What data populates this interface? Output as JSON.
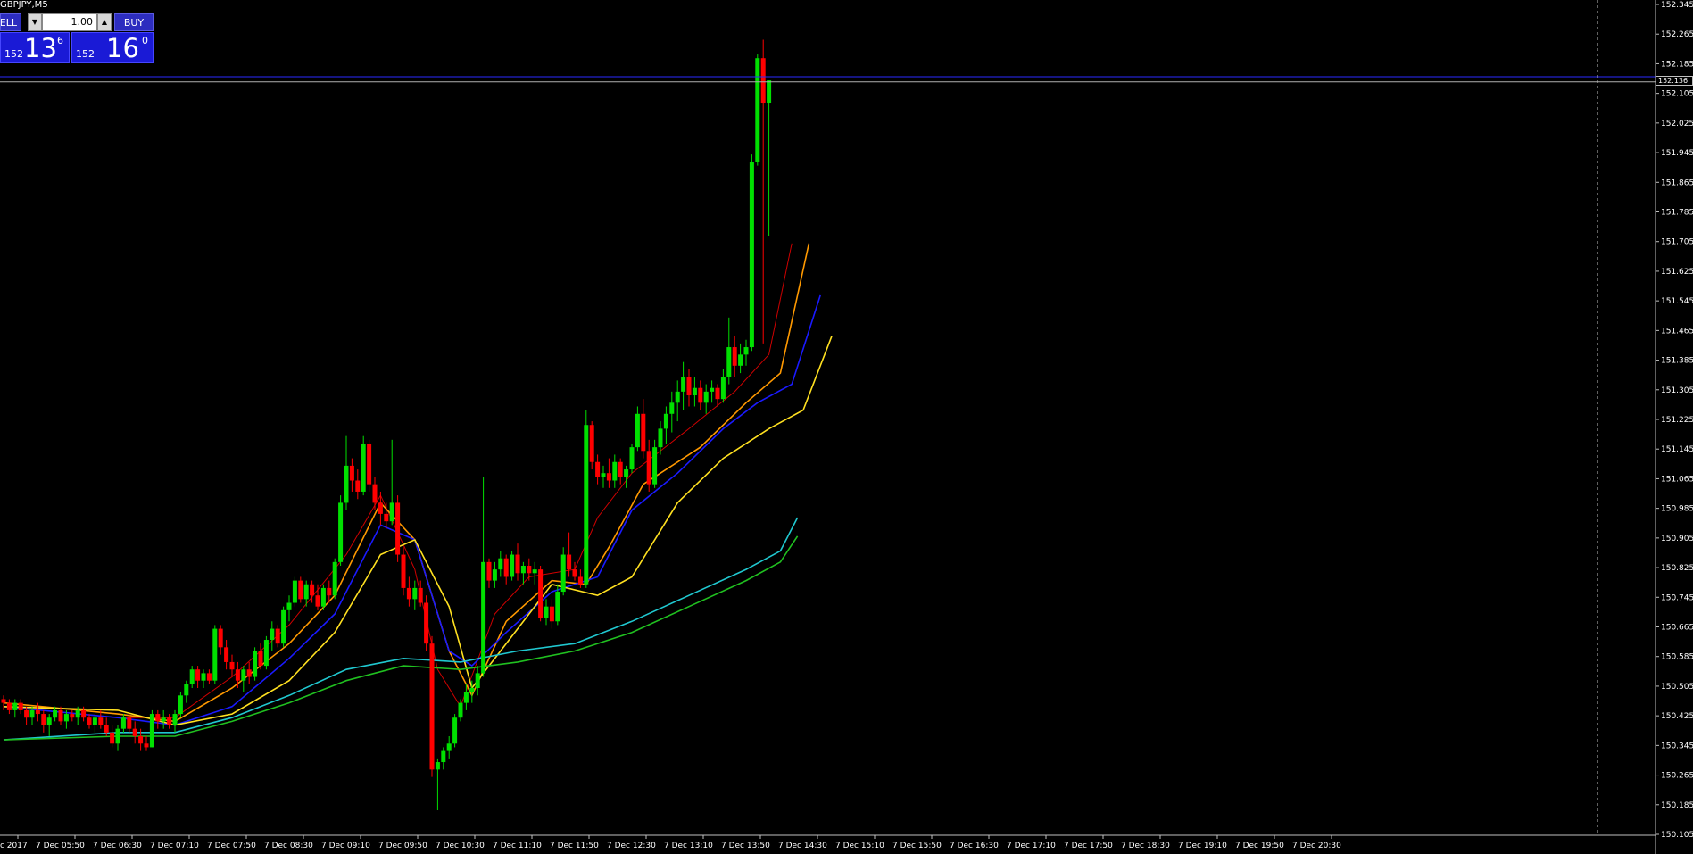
{
  "window": {
    "symbol_label": "GBPJPY,M5"
  },
  "trade_panel": {
    "sell_label": "ELL",
    "buy_label": "BUY",
    "lot_value": "1.00",
    "lot_down_icon": "arrow-down-icon",
    "lot_up_icon": "arrow-up-icon",
    "sell_quote": {
      "prefix": "152",
      "big": "13",
      "sup": "6"
    },
    "buy_quote": {
      "prefix": "152",
      "big": "16",
      "sup": "0"
    }
  },
  "price_tag": "152.136",
  "colors": {
    "bull": "#00e000",
    "bear": "#ff0000",
    "ma_red": "#d00000",
    "ma_orange": "#ff9900",
    "ma_blue": "#1a1aff",
    "ma_yellow": "#ffe020",
    "ma_cyan": "#20c8d0",
    "ma_green": "#20c020",
    "ask_line": "#2a2aff",
    "bid_line": "#b0b0b0"
  },
  "chart_data": {
    "type": "candlestick",
    "y_tick_labels": [
      "152.345",
      "152.265",
      "152.185",
      "152.105",
      "152.025",
      "151.945",
      "151.865",
      "151.785",
      "151.705",
      "151.625",
      "151.545",
      "151.465",
      "151.385",
      "151.305",
      "151.225",
      "151.145",
      "151.065",
      "150.985",
      "150.905",
      "150.825",
      "150.745",
      "150.665",
      "150.585",
      "150.505",
      "150.425",
      "150.345",
      "150.265",
      "150.185",
      "150.105"
    ],
    "x_tick_labels": [
      "c 2017",
      "7 Dec 05:50",
      "7 Dec 06:30",
      "7 Dec 07:10",
      "7 Dec 07:50",
      "7 Dec 08:30",
      "7 Dec 09:10",
      "7 Dec 09:50",
      "7 Dec 10:30",
      "7 Dec 11:10",
      "7 Dec 11:50",
      "7 Dec 12:30",
      "7 Dec 13:10",
      "7 Dec 13:50",
      "7 Dec 14:30",
      "7 Dec 15:10",
      "7 Dec 15:50",
      "7 Dec 16:30",
      "7 Dec 17:10",
      "7 Dec 17:50",
      "7 Dec 18:30",
      "7 Dec 19:10",
      "7 Dec 19:50",
      "7 Dec 20:30"
    ],
    "ask_level": 152.15,
    "bid_level": 152.136,
    "ohlc": [
      [
        150.47,
        150.48,
        150.44,
        150.46
      ],
      [
        150.46,
        150.47,
        150.43,
        150.44
      ],
      [
        150.44,
        150.47,
        150.42,
        150.46
      ],
      [
        150.46,
        150.47,
        150.43,
        150.44
      ],
      [
        150.44,
        150.45,
        150.4,
        150.42
      ],
      [
        150.42,
        150.45,
        150.4,
        150.44
      ],
      [
        150.44,
        150.46,
        150.41,
        150.43
      ],
      [
        150.43,
        150.44,
        150.38,
        150.4
      ],
      [
        150.4,
        150.43,
        150.37,
        150.42
      ],
      [
        150.42,
        150.45,
        150.41,
        150.44
      ],
      [
        150.44,
        150.45,
        150.4,
        150.41
      ],
      [
        150.41,
        150.44,
        150.39,
        150.43
      ],
      [
        150.43,
        150.44,
        150.41,
        150.42
      ],
      [
        150.42,
        150.45,
        150.4,
        150.44
      ],
      [
        150.44,
        150.45,
        150.41,
        150.42
      ],
      [
        150.42,
        150.43,
        150.39,
        150.4
      ],
      [
        150.4,
        150.43,
        150.38,
        150.42
      ],
      [
        150.42,
        150.44,
        150.39,
        150.4
      ],
      [
        150.4,
        150.42,
        150.37,
        150.38
      ],
      [
        150.38,
        150.4,
        150.34,
        150.35
      ],
      [
        150.35,
        150.4,
        150.33,
        150.39
      ],
      [
        150.39,
        150.43,
        150.38,
        150.42
      ],
      [
        150.42,
        150.43,
        150.38,
        150.39
      ],
      [
        150.39,
        150.41,
        150.35,
        150.37
      ],
      [
        150.37,
        150.39,
        150.33,
        150.35
      ],
      [
        150.35,
        150.37,
        150.33,
        150.34
      ],
      [
        150.34,
        150.44,
        150.34,
        150.43
      ],
      [
        150.43,
        150.44,
        150.39,
        150.41
      ],
      [
        150.41,
        150.44,
        150.39,
        150.42
      ],
      [
        150.42,
        150.43,
        150.39,
        150.4
      ],
      [
        150.4,
        150.44,
        150.38,
        150.43
      ],
      [
        150.43,
        150.49,
        150.42,
        150.48
      ],
      [
        150.48,
        150.52,
        150.46,
        150.51
      ],
      [
        150.51,
        150.56,
        150.5,
        150.55
      ],
      [
        150.55,
        150.56,
        150.5,
        150.52
      ],
      [
        150.52,
        150.55,
        150.5,
        150.54
      ],
      [
        150.54,
        150.55,
        150.51,
        150.52
      ],
      [
        150.52,
        150.67,
        150.51,
        150.66
      ],
      [
        150.66,
        150.67,
        150.59,
        150.61
      ],
      [
        150.61,
        150.63,
        150.55,
        150.57
      ],
      [
        150.57,
        150.59,
        150.53,
        150.55
      ],
      [
        150.55,
        150.57,
        150.5,
        150.52
      ],
      [
        150.52,
        150.56,
        150.49,
        150.55
      ],
      [
        150.55,
        150.57,
        150.51,
        150.53
      ],
      [
        150.53,
        150.61,
        150.52,
        150.6
      ],
      [
        150.6,
        150.62,
        150.55,
        150.56
      ],
      [
        150.56,
        150.64,
        150.55,
        150.63
      ],
      [
        150.63,
        150.68,
        150.6,
        150.66
      ],
      [
        150.66,
        150.67,
        150.61,
        150.62
      ],
      [
        150.62,
        150.72,
        150.61,
        150.71
      ],
      [
        150.71,
        150.75,
        150.68,
        150.73
      ],
      [
        150.73,
        150.8,
        150.72,
        150.79
      ],
      [
        150.79,
        150.8,
        150.73,
        150.74
      ],
      [
        150.74,
        150.79,
        150.72,
        150.78
      ],
      [
        150.78,
        150.79,
        150.73,
        150.75
      ],
      [
        150.75,
        150.78,
        150.71,
        150.72
      ],
      [
        150.72,
        150.78,
        150.71,
        150.77
      ],
      [
        150.77,
        150.79,
        150.73,
        150.75
      ],
      [
        150.75,
        150.85,
        150.74,
        150.84
      ],
      [
        150.84,
        151.02,
        150.83,
        151.0
      ],
      [
        151.0,
        151.18,
        150.98,
        151.1
      ],
      [
        151.1,
        151.12,
        151.03,
        151.06
      ],
      [
        151.06,
        151.09,
        151.01,
        151.03
      ],
      [
        151.03,
        151.18,
        151.02,
        151.16
      ],
      [
        151.16,
        151.17,
        151.03,
        151.05
      ],
      [
        151.05,
        151.07,
        150.98,
        151.0
      ],
      [
        151.0,
        151.03,
        150.94,
        150.97
      ],
      [
        150.97,
        151.0,
        150.93,
        150.95
      ],
      [
        150.95,
        151.17,
        150.94,
        151.0
      ],
      [
        151.0,
        151.02,
        150.84,
        150.86
      ],
      [
        150.86,
        150.88,
        150.75,
        150.77
      ],
      [
        150.77,
        150.8,
        150.72,
        150.74
      ],
      [
        150.74,
        150.79,
        150.71,
        150.77
      ],
      [
        150.77,
        150.79,
        150.72,
        150.73
      ],
      [
        150.73,
        150.75,
        150.6,
        150.62
      ],
      [
        150.62,
        150.64,
        150.26,
        150.28
      ],
      [
        150.28,
        150.31,
        150.17,
        150.3
      ],
      [
        150.3,
        150.34,
        150.28,
        150.33
      ],
      [
        150.33,
        150.37,
        150.31,
        150.35
      ],
      [
        150.35,
        150.43,
        150.34,
        150.42
      ],
      [
        150.42,
        150.47,
        150.41,
        150.46
      ],
      [
        150.46,
        150.51,
        150.44,
        150.49
      ],
      [
        150.49,
        150.52,
        150.46,
        150.5
      ],
      [
        150.5,
        150.56,
        150.48,
        150.54
      ],
      [
        150.54,
        151.07,
        150.53,
        150.84
      ],
      [
        150.84,
        150.85,
        150.77,
        150.79
      ],
      [
        150.79,
        150.84,
        150.77,
        150.82
      ],
      [
        150.82,
        150.87,
        150.8,
        150.85
      ],
      [
        150.85,
        150.86,
        150.78,
        150.8
      ],
      [
        150.8,
        150.87,
        150.79,
        150.86
      ],
      [
        150.86,
        150.89,
        150.79,
        150.81
      ],
      [
        150.81,
        150.84,
        150.78,
        150.83
      ],
      [
        150.83,
        150.85,
        150.79,
        150.81
      ],
      [
        150.81,
        150.84,
        150.78,
        150.82
      ],
      [
        150.82,
        150.83,
        150.68,
        150.69
      ],
      [
        150.69,
        150.74,
        150.67,
        150.72
      ],
      [
        150.72,
        150.74,
        150.66,
        150.68
      ],
      [
        150.68,
        150.78,
        150.67,
        150.76
      ],
      [
        150.76,
        150.88,
        150.75,
        150.86
      ],
      [
        150.86,
        150.92,
        150.8,
        150.82
      ],
      [
        150.82,
        150.84,
        150.79,
        150.8
      ],
      [
        150.8,
        150.82,
        150.77,
        150.78
      ],
      [
        150.78,
        151.25,
        150.77,
        151.21
      ],
      [
        151.21,
        151.22,
        151.09,
        151.11
      ],
      [
        151.11,
        151.13,
        151.05,
        151.07
      ],
      [
        151.07,
        151.1,
        151.04,
        151.08
      ],
      [
        151.08,
        151.12,
        151.04,
        151.06
      ],
      [
        151.06,
        151.13,
        151.04,
        151.11
      ],
      [
        151.11,
        151.12,
        151.05,
        151.07
      ],
      [
        151.07,
        151.1,
        151.04,
        151.09
      ],
      [
        151.09,
        151.16,
        151.08,
        151.15
      ],
      [
        151.15,
        151.26,
        151.14,
        151.24
      ],
      [
        151.24,
        151.28,
        151.12,
        151.14
      ],
      [
        151.14,
        151.17,
        151.03,
        151.05
      ],
      [
        151.05,
        151.17,
        151.04,
        151.15
      ],
      [
        151.15,
        151.22,
        151.13,
        151.2
      ],
      [
        151.2,
        151.26,
        151.16,
        151.24
      ],
      [
        151.24,
        151.3,
        151.19,
        151.27
      ],
      [
        151.27,
        151.33,
        151.22,
        151.3
      ],
      [
        151.3,
        151.38,
        151.25,
        151.34
      ],
      [
        151.34,
        151.36,
        151.26,
        151.29
      ],
      [
        151.29,
        151.34,
        151.26,
        151.31
      ],
      [
        151.31,
        151.33,
        151.25,
        151.27
      ],
      [
        151.27,
        151.32,
        151.24,
        151.3
      ],
      [
        151.3,
        151.33,
        151.27,
        151.31
      ],
      [
        151.31,
        151.32,
        151.26,
        151.28
      ],
      [
        151.28,
        151.36,
        151.27,
        151.34
      ],
      [
        151.34,
        151.5,
        151.32,
        151.42
      ],
      [
        151.42,
        151.45,
        151.34,
        151.37
      ],
      [
        151.37,
        151.43,
        151.35,
        151.4
      ],
      [
        151.4,
        151.44,
        151.37,
        151.42
      ],
      [
        151.42,
        151.94,
        151.41,
        151.92
      ],
      [
        151.92,
        152.21,
        151.91,
        152.2
      ],
      [
        152.2,
        152.25,
        151.43,
        152.08
      ],
      [
        152.08,
        152.14,
        151.72,
        152.14
      ]
    ],
    "ma_series": [
      {
        "color": "ma_red",
        "values": [
          [
            0,
            150.45
          ],
          [
            20,
            150.42
          ],
          [
            30,
            150.42
          ],
          [
            40,
            150.53
          ],
          [
            50,
            150.67
          ],
          [
            60,
            150.86
          ],
          [
            66,
            151.02
          ],
          [
            72,
            150.82
          ],
          [
            76,
            150.55
          ],
          [
            80,
            150.45
          ],
          [
            86,
            150.7
          ],
          [
            92,
            150.8
          ],
          [
            100,
            150.82
          ],
          [
            104,
            150.96
          ],
          [
            110,
            151.08
          ],
          [
            120,
            151.2
          ],
          [
            128,
            151.3
          ],
          [
            134,
            151.4
          ],
          [
            138,
            151.7
          ]
        ]
      },
      {
        "color": "ma_orange",
        "values": [
          [
            0,
            150.46
          ],
          [
            20,
            150.43
          ],
          [
            30,
            150.41
          ],
          [
            40,
            150.5
          ],
          [
            50,
            150.62
          ],
          [
            58,
            150.75
          ],
          [
            66,
            151.0
          ],
          [
            72,
            150.9
          ],
          [
            78,
            150.6
          ],
          [
            82,
            150.48
          ],
          [
            88,
            150.68
          ],
          [
            96,
            150.79
          ],
          [
            102,
            150.78
          ],
          [
            106,
            150.88
          ],
          [
            112,
            151.05
          ],
          [
            122,
            151.15
          ],
          [
            130,
            151.27
          ],
          [
            136,
            151.35
          ],
          [
            141,
            151.7
          ]
        ]
      },
      {
        "color": "ma_blue",
        "values": [
          [
            0,
            150.45
          ],
          [
            20,
            150.42
          ],
          [
            30,
            150.4
          ],
          [
            40,
            150.45
          ],
          [
            50,
            150.58
          ],
          [
            58,
            150.7
          ],
          [
            66,
            150.94
          ],
          [
            72,
            150.9
          ],
          [
            78,
            150.6
          ],
          [
            82,
            150.56
          ],
          [
            88,
            150.65
          ],
          [
            96,
            150.76
          ],
          [
            104,
            150.8
          ],
          [
            110,
            150.98
          ],
          [
            118,
            151.08
          ],
          [
            126,
            151.2
          ],
          [
            132,
            151.27
          ],
          [
            138,
            151.32
          ],
          [
            143,
            151.56
          ]
        ]
      },
      {
        "color": "ma_yellow",
        "values": [
          [
            0,
            150.45
          ],
          [
            20,
            150.44
          ],
          [
            30,
            150.4
          ],
          [
            40,
            150.43
          ],
          [
            50,
            150.52
          ],
          [
            58,
            150.65
          ],
          [
            66,
            150.86
          ],
          [
            72,
            150.9
          ],
          [
            78,
            150.72
          ],
          [
            82,
            150.5
          ],
          [
            88,
            150.62
          ],
          [
            96,
            150.78
          ],
          [
            104,
            150.75
          ],
          [
            110,
            150.8
          ],
          [
            118,
            151.0
          ],
          [
            126,
            151.12
          ],
          [
            134,
            151.2
          ],
          [
            140,
            151.25
          ],
          [
            145,
            151.45
          ]
        ]
      },
      {
        "color": "ma_cyan",
        "values": [
          [
            0,
            150.36
          ],
          [
            20,
            150.38
          ],
          [
            30,
            150.38
          ],
          [
            40,
            150.42
          ],
          [
            50,
            150.48
          ],
          [
            60,
            150.55
          ],
          [
            70,
            150.58
          ],
          [
            80,
            150.57
          ],
          [
            90,
            150.6
          ],
          [
            100,
            150.62
          ],
          [
            110,
            150.68
          ],
          [
            120,
            150.75
          ],
          [
            130,
            150.82
          ],
          [
            136,
            150.87
          ],
          [
            139,
            150.96
          ]
        ]
      },
      {
        "color": "ma_green",
        "values": [
          [
            0,
            150.36
          ],
          [
            20,
            150.37
          ],
          [
            30,
            150.37
          ],
          [
            40,
            150.41
          ],
          [
            50,
            150.46
          ],
          [
            60,
            150.52
          ],
          [
            70,
            150.56
          ],
          [
            80,
            150.55
          ],
          [
            90,
            150.57
          ],
          [
            100,
            150.6
          ],
          [
            110,
            150.65
          ],
          [
            120,
            150.72
          ],
          [
            130,
            150.79
          ],
          [
            136,
            150.84
          ],
          [
            139,
            150.91
          ]
        ]
      }
    ]
  }
}
